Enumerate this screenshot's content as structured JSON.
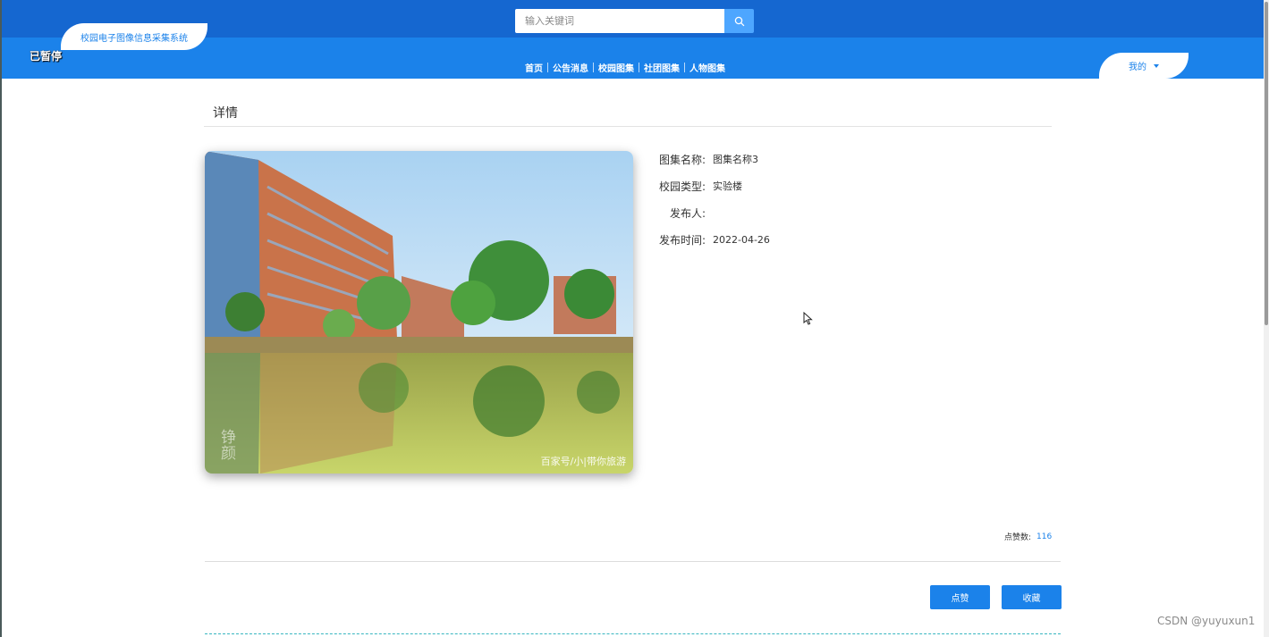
{
  "header": {
    "site_title": "校园电子图像信息采集系统",
    "paused_label": "已暂停",
    "search": {
      "placeholder": "输入关键词",
      "value": "",
      "icon": "search-icon"
    },
    "nav": [
      {
        "label": "首页"
      },
      {
        "label": "公告消息"
      },
      {
        "label": "校园图集"
      },
      {
        "label": "社团图集"
      },
      {
        "label": "人物图集"
      }
    ],
    "user_menu": {
      "label": "我的",
      "icon": "caret-down-icon"
    }
  },
  "detail": {
    "section_title": "详情",
    "image": {
      "watermark_right": "百家号/小|带你旅游",
      "watermark_left": "铮颜"
    },
    "fields": [
      {
        "label": "图集名称:",
        "value": "图集名称3"
      },
      {
        "label": "校园类型:",
        "value": "实验楼"
      },
      {
        "label": "发布人:",
        "value": ""
      },
      {
        "label": "发布时间:",
        "value": "2022-04-26"
      }
    ],
    "likes": {
      "label": "点赞数:",
      "count": "116"
    },
    "actions": {
      "like": "点赞",
      "favorite": "收藏"
    }
  },
  "footer": {
    "watermark": "CSDN @yuyuxun1"
  },
  "colors": {
    "primary": "#1b82ea",
    "header_dark": "#1567d0",
    "search_button": "#4da6ff"
  }
}
